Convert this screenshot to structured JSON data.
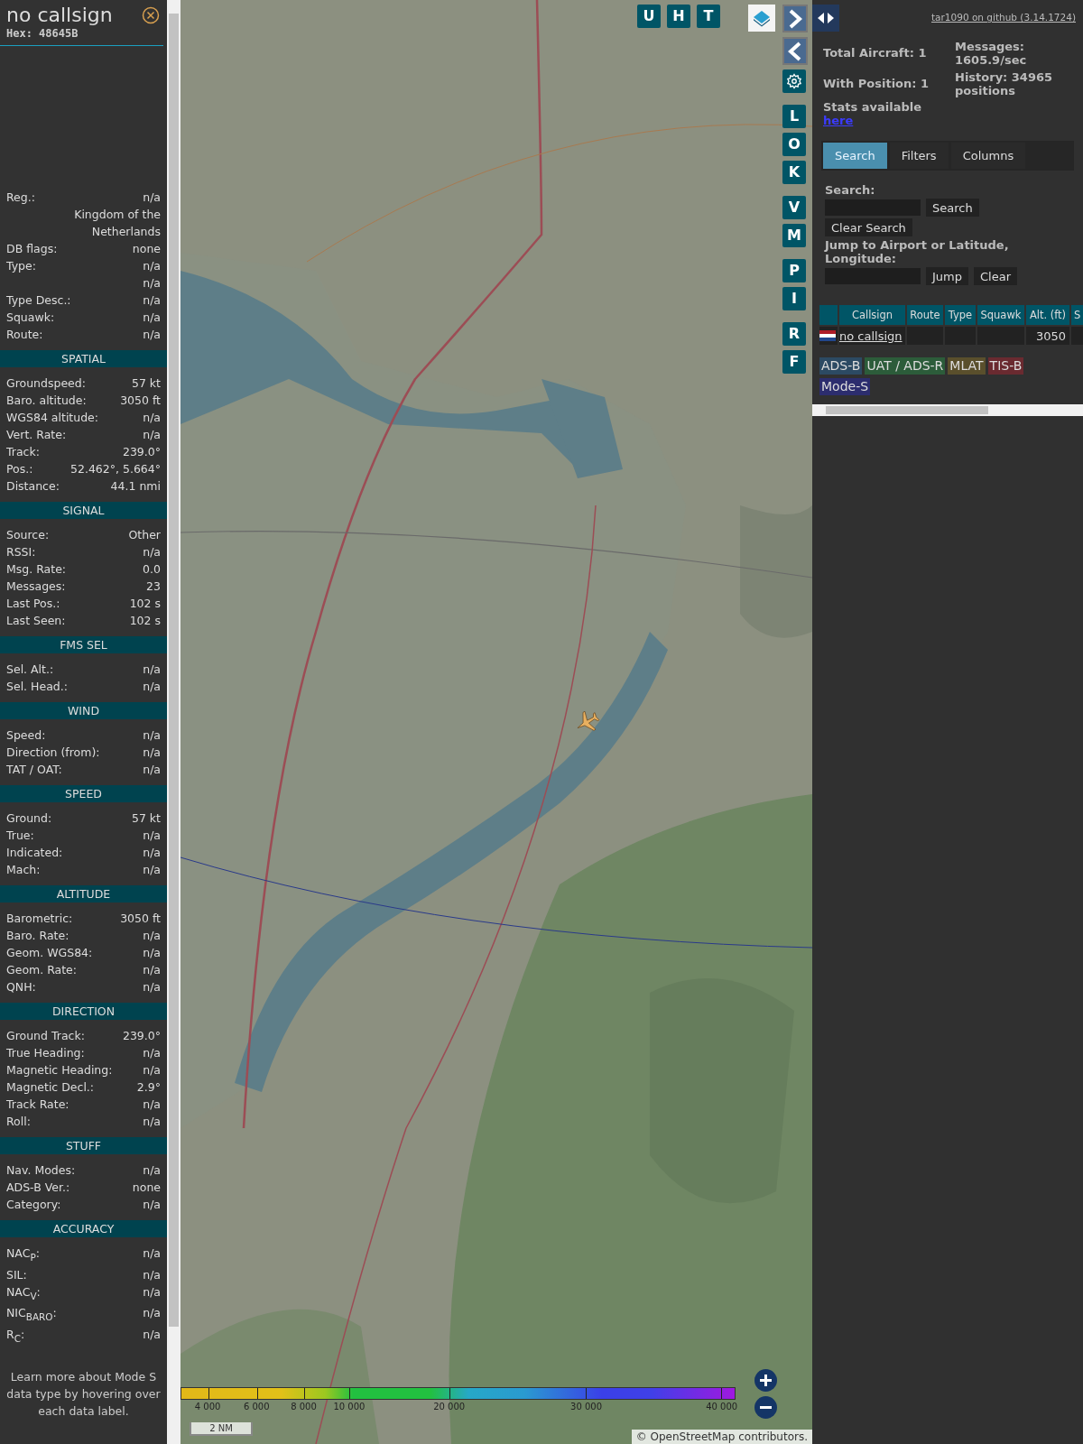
{
  "sidebar": {
    "title": "no callsign",
    "hex": "Hex: 48645B",
    "info_rows": [
      {
        "label": "Reg.:",
        "value": "n/a"
      },
      {
        "value": "Kingdom of the Netherlands"
      },
      {
        "label": "DB flags:",
        "value": "none"
      },
      {
        "label": "Type:",
        "value": "n/a"
      },
      {
        "value": "n/a"
      },
      {
        "label": "Type Desc.:",
        "value": "n/a"
      },
      {
        "label": "Squawk:",
        "value": "n/a"
      },
      {
        "label": "Route:",
        "value": "n/a"
      }
    ],
    "sections": [
      {
        "title": "SPATIAL",
        "rows": [
          {
            "label": "Groundspeed:",
            "value": "57 kt"
          },
          {
            "label": "Baro. altitude:",
            "value": "3050 ft"
          },
          {
            "label": "WGS84 altitude:",
            "value": "n/a"
          },
          {
            "label": "Vert. Rate:",
            "value": "n/a"
          },
          {
            "label": "Track:",
            "value": "239.0°"
          },
          {
            "label": "Pos.:",
            "value": "52.462°, 5.664°"
          },
          {
            "label": "Distance:",
            "value": "44.1 nmi"
          }
        ]
      },
      {
        "title": "SIGNAL",
        "rows": [
          {
            "label": "Source:",
            "value": "Other"
          },
          {
            "label": "RSSI:",
            "value": "n/a"
          },
          {
            "label": "Msg. Rate:",
            "value": "0.0"
          },
          {
            "label": "Messages:",
            "value": "23"
          },
          {
            "label": "Last Pos.:",
            "value": "102 s"
          },
          {
            "label": "Last Seen:",
            "value": "102 s"
          }
        ]
      },
      {
        "title": "FMS SEL",
        "rows": [
          {
            "label": "Sel. Alt.:",
            "value": "n/a"
          },
          {
            "label": "Sel. Head.:",
            "value": "n/a"
          }
        ]
      },
      {
        "title": "WIND",
        "rows": [
          {
            "label": "Speed:",
            "value": "n/a"
          },
          {
            "label": "Direction (from):",
            "value": "n/a"
          },
          {
            "label": "TAT / OAT:",
            "value": "n/a"
          }
        ]
      },
      {
        "title": "SPEED",
        "rows": [
          {
            "label": "Ground:",
            "value": "57 kt"
          },
          {
            "label": "True:",
            "value": "n/a"
          },
          {
            "label": "Indicated:",
            "value": "n/a"
          },
          {
            "label": "Mach:",
            "value": "n/a"
          }
        ]
      },
      {
        "title": "ALTITUDE",
        "rows": [
          {
            "label": "Barometric:",
            "value": "3050 ft"
          },
          {
            "label": "Baro. Rate:",
            "value": "n/a"
          },
          {
            "label": "Geom. WGS84:",
            "value": "n/a"
          },
          {
            "label": "Geom. Rate:",
            "value": "n/a"
          },
          {
            "label": "QNH:",
            "value": "n/a"
          }
        ]
      },
      {
        "title": "DIRECTION",
        "rows": [
          {
            "label": "Ground Track:",
            "value": "239.0°"
          },
          {
            "label": "True Heading:",
            "value": "n/a"
          },
          {
            "label": "Magnetic Heading:",
            "value": "n/a"
          },
          {
            "label": "Magnetic Decl.:",
            "value": "2.9°"
          },
          {
            "label": "Track Rate:",
            "value": "n/a"
          },
          {
            "label": "Roll:",
            "value": "n/a"
          }
        ]
      },
      {
        "title": "STUFF",
        "rows": [
          {
            "label": "Nav. Modes:",
            "value": "n/a"
          },
          {
            "label": "ADS-B Ver.:",
            "value": "none"
          },
          {
            "label": "Category:",
            "value": "n/a"
          }
        ]
      },
      {
        "title": "ACCURACY",
        "rows": [
          {
            "label": "NAC$_{P}$:",
            "value": "n/a"
          },
          {
            "label": "SIL:",
            "value": "n/a"
          },
          {
            "label": "NAC$_{V}$:",
            "value": "n/a"
          },
          {
            "label": "NIC$_{BARO}$:",
            "value": "n/a"
          },
          {
            "label": "R$_{C}$:",
            "value": "n/a"
          }
        ]
      }
    ],
    "footer": "Learn more about Mode S data type by hovering over each data label."
  },
  "map": {
    "top_buttons": [
      {
        "label": "U"
      },
      {
        "label": "H"
      },
      {
        "label": "T"
      }
    ],
    "side_groups": [
      [
        {
          "label": "L"
        },
        {
          "label": "O"
        },
        {
          "label": "K"
        }
      ],
      [
        {
          "label": "V"
        },
        {
          "label": "M"
        }
      ],
      [
        {
          "label": "P"
        },
        {
          "label": "I"
        }
      ],
      [
        {
          "label": "R"
        },
        {
          "label": "F"
        }
      ]
    ],
    "altitude_ticks": [
      "4 000",
      "6 000",
      "8 000",
      "10 000",
      "20 000",
      "30 000",
      "40 000"
    ],
    "scale": "2 NM",
    "attribution": {
      "prefix": "© ",
      "link": "OpenStreetMap",
      "suffix": " contributors."
    }
  },
  "panel": {
    "github_link": "tar1090 on github (3.14.1724)",
    "stats": {
      "total": "Total Aircraft: 1",
      "with_position": "With Position: 1",
      "messages": "Messages: 1605.9/sec",
      "history": "History: 34965 positions",
      "stats_text": "Stats available",
      "stats_link": "here"
    },
    "tabs": [
      {
        "label": "Search",
        "selected": true
      },
      {
        "label": "Filters",
        "selected": false
      },
      {
        "label": "Columns",
        "selected": false
      }
    ],
    "search": {
      "label": "Search:",
      "search_button": "Search",
      "clear_button": "Clear Search",
      "jump_label": "Jump to Airport or Latitude, Longitude:",
      "jump_button": "Jump",
      "jump_clear": "Clear"
    },
    "table": {
      "columns": [
        "Callsign",
        "Route",
        "Type",
        "Squawk",
        "Alt. (ft)",
        "S"
      ],
      "rows": [
        {
          "callsign": "no callsign",
          "altitude": "3050"
        }
      ]
    },
    "tags": [
      {
        "label": "ADS-B",
        "color": "#2c4a63"
      },
      {
        "label": "UAT / ADS-R",
        "color": "#2c5c3a"
      },
      {
        "label": "MLAT",
        "color": "#5a4f2c"
      },
      {
        "label": "TIS-B",
        "color": "#6a2a30"
      },
      {
        "label": "Mode-S",
        "color": "#2c2d6e"
      }
    ]
  }
}
